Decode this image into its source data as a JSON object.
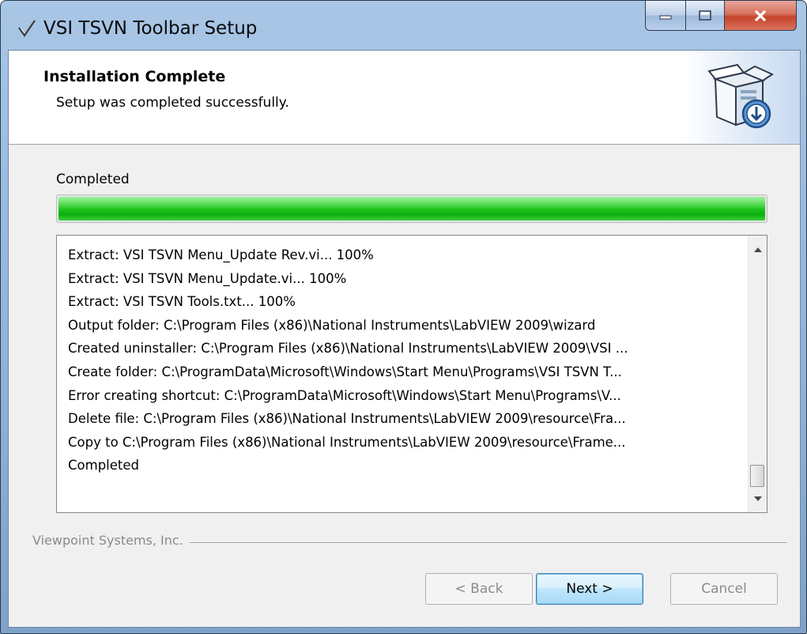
{
  "window": {
    "title": "VSI TSVN Toolbar Setup"
  },
  "header": {
    "title": "Installation Complete",
    "subtitle": "Setup was completed successfully."
  },
  "status": {
    "label": "Completed",
    "progress_percent": 100
  },
  "log": {
    "lines": [
      "Extract: VSI TSVN Menu_Update Rev.vi... 100%",
      "Extract: VSI TSVN Menu_Update.vi... 100%",
      "Extract: VSI TSVN Tools.txt... 100%",
      "Output folder: C:\\Program Files (x86)\\National Instruments\\LabVIEW 2009\\wizard",
      "Created uninstaller: C:\\Program Files (x86)\\National Instruments\\LabVIEW 2009\\VSI ...",
      "Create folder: C:\\ProgramData\\Microsoft\\Windows\\Start Menu\\Programs\\VSI TSVN T...",
      "Error creating shortcut: C:\\ProgramData\\Microsoft\\Windows\\Start Menu\\Programs\\V...",
      "Delete file: C:\\Program Files (x86)\\National Instruments\\LabVIEW 2009\\resource\\Fra...",
      "Copy to C:\\Program Files (x86)\\National Instruments\\LabVIEW 2009\\resource\\Frame...",
      "Completed"
    ]
  },
  "footer": {
    "branding": "Viewpoint Systems, Inc.",
    "back_label": "< Back",
    "next_label": "Next >",
    "cancel_label": "Cancel"
  },
  "icons": {
    "app": "checkmark-icon",
    "header": "install-box-icon",
    "minimize": "minimize-icon",
    "maximize": "maximize-icon",
    "close": "close-icon"
  },
  "colors": {
    "progress_fill": "#18c218",
    "close_button": "#c7442b",
    "default_button_border": "#3c7fb1"
  }
}
